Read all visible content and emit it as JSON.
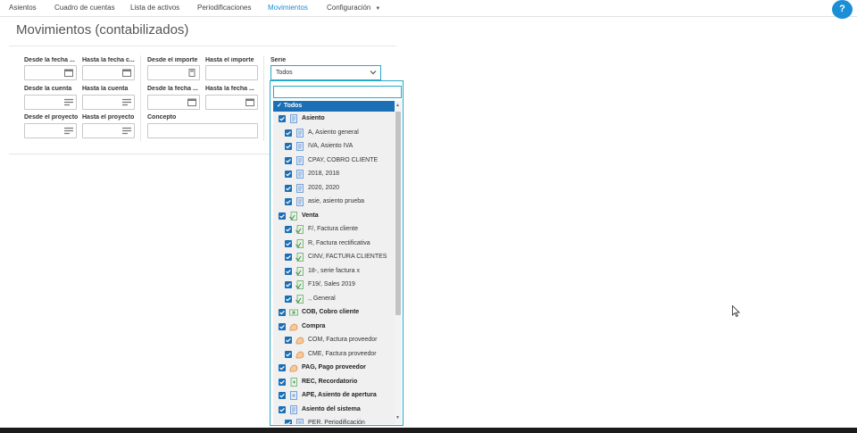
{
  "nav": {
    "items": [
      {
        "label": "Asientos"
      },
      {
        "label": "Cuadro de cuentas"
      },
      {
        "label": "Lista de activos"
      },
      {
        "label": "Periodificaciones"
      },
      {
        "label": "Movimientos",
        "active": true
      },
      {
        "label": "Configuración"
      }
    ],
    "help_label": "?"
  },
  "page": {
    "title": "Movimientos (contabilizados)"
  },
  "filters": {
    "desde_fecha": "Desde la fecha ...",
    "hasta_fecha": "Hasta la fecha c...",
    "desde_importe": "Desde el importe",
    "hasta_importe": "Hasta el importe",
    "serie": "Serie",
    "desde_cuenta": "Desde la cuenta",
    "hasta_cuenta": "Hasta la cuenta",
    "desde_fecha2": "Desde la fecha ...",
    "hasta_fecha2": "Hasta la fecha ...",
    "desde_proyecto": "Desde el proyecto",
    "hasta_proyecto": "Hasta el proyecto",
    "concepto": "Concepto"
  },
  "serie_select": {
    "value": "Todos"
  },
  "dropdown": {
    "search_placeholder": "",
    "all_label": "Todos",
    "items": [
      {
        "label": "Asiento",
        "bold": true,
        "icon": "document-icon"
      },
      {
        "label": "A, Asiento general",
        "icon": "document-icon"
      },
      {
        "label": "IVA, Asiento IVA",
        "icon": "document-icon"
      },
      {
        "label": "CPAY, COBRO CLIENTE",
        "icon": "document-icon"
      },
      {
        "label": "2018, 2018",
        "icon": "document-icon"
      },
      {
        "label": "2020, 2020",
        "icon": "document-icon"
      },
      {
        "label": "asie, asiento prueba",
        "icon": "document-icon"
      },
      {
        "label": "Venta",
        "bold": true,
        "icon": "sale-icon"
      },
      {
        "label": "F/, Factura cliente",
        "icon": "sale-icon"
      },
      {
        "label": "R, Factura rectificativa",
        "icon": "sale-icon"
      },
      {
        "label": "CINV, FACTURA CLIENTES",
        "icon": "sale-icon"
      },
      {
        "label": "18-, serie factura x",
        "icon": "sale-icon"
      },
      {
        "label": "F19/, Sales 2019",
        "icon": "sale-icon"
      },
      {
        "label": "., General",
        "icon": "sale-icon"
      },
      {
        "label": "COB, Cobro cliente",
        "bold": true,
        "icon": "payment-icon"
      },
      {
        "label": "Compra",
        "bold": true,
        "icon": "purchase-icon"
      },
      {
        "label": "COM, Factura proveedor",
        "icon": "purchase-icon"
      },
      {
        "label": "CME, Factura proveedor",
        "icon": "purchase-icon"
      },
      {
        "label": "PAG, Pago proveedor",
        "bold": true,
        "icon": "purchase-icon"
      },
      {
        "label": "REC, Recordatorio",
        "bold": true,
        "icon": "reminder-icon"
      },
      {
        "label": "APE, Asiento de apertura",
        "bold": true,
        "icon": "opening-icon"
      },
      {
        "label": "Asiento del sistema",
        "bold": true,
        "icon": "document-icon"
      },
      {
        "label": "PER, Periodificación",
        "icon": "document-icon"
      }
    ]
  },
  "colors": {
    "accent": "#1a8fd6",
    "check": "#1a6fb5",
    "border_focus": "#27a9c9"
  }
}
